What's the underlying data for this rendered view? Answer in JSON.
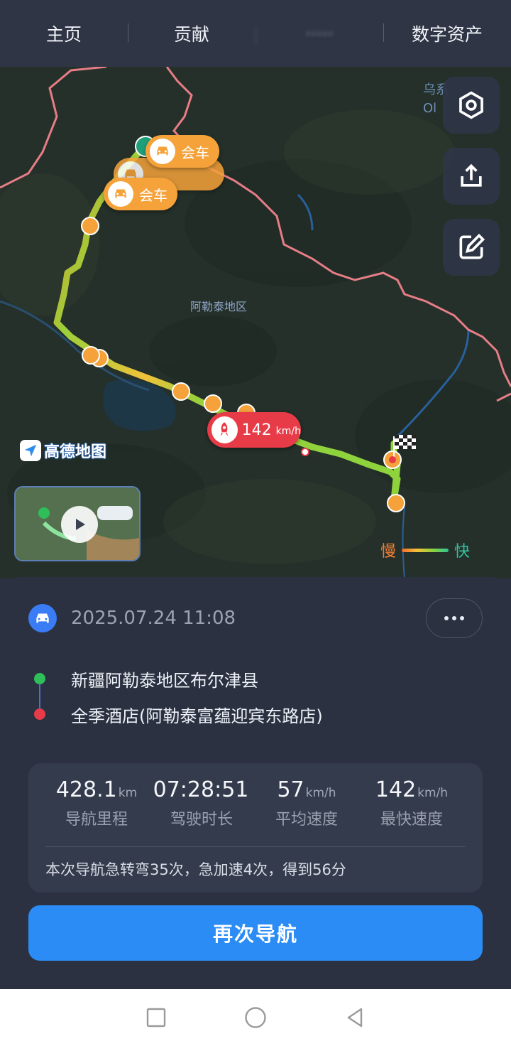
{
  "top_tabs": [
    {
      "label": "主页"
    },
    {
      "label": "贡献"
    },
    {
      "label": "·····"
    },
    {
      "label": "数字资产"
    }
  ],
  "map": {
    "place_label": "阿勒泰地区",
    "corner_label_line1": "乌系",
    "corner_label_line2": "Ol",
    "event_bubbles": [
      {
        "label": "会车"
      },
      {
        "label": "会车"
      }
    ],
    "max_speed": {
      "value": "142",
      "unit": "km/h"
    },
    "logo_text": "高德地图",
    "legend": {
      "slow": "慢",
      "fast": "快"
    }
  },
  "trip": {
    "datetime": "2025.07.24 11:08",
    "origin": "新疆阿勒泰地区布尔津县",
    "destination": "全季酒店(阿勒泰富蕴迎宾东路店)"
  },
  "stats": [
    {
      "value": "428.1",
      "unit": "km",
      "label": "导航里程"
    },
    {
      "value": "07:28:51",
      "unit": "",
      "label": "驾驶时长"
    },
    {
      "value": "57",
      "unit": "km/h",
      "label": "平均速度"
    },
    {
      "value": "142",
      "unit": "km/h",
      "label": "最快速度"
    }
  ],
  "summary": "本次导航急转弯35次，急加速4次，得到56分",
  "renavigate_label": "再次导航",
  "colors": {
    "accent": "#2b8cf5",
    "speed_alert": "#e83b48",
    "event": "#f6a23a"
  }
}
